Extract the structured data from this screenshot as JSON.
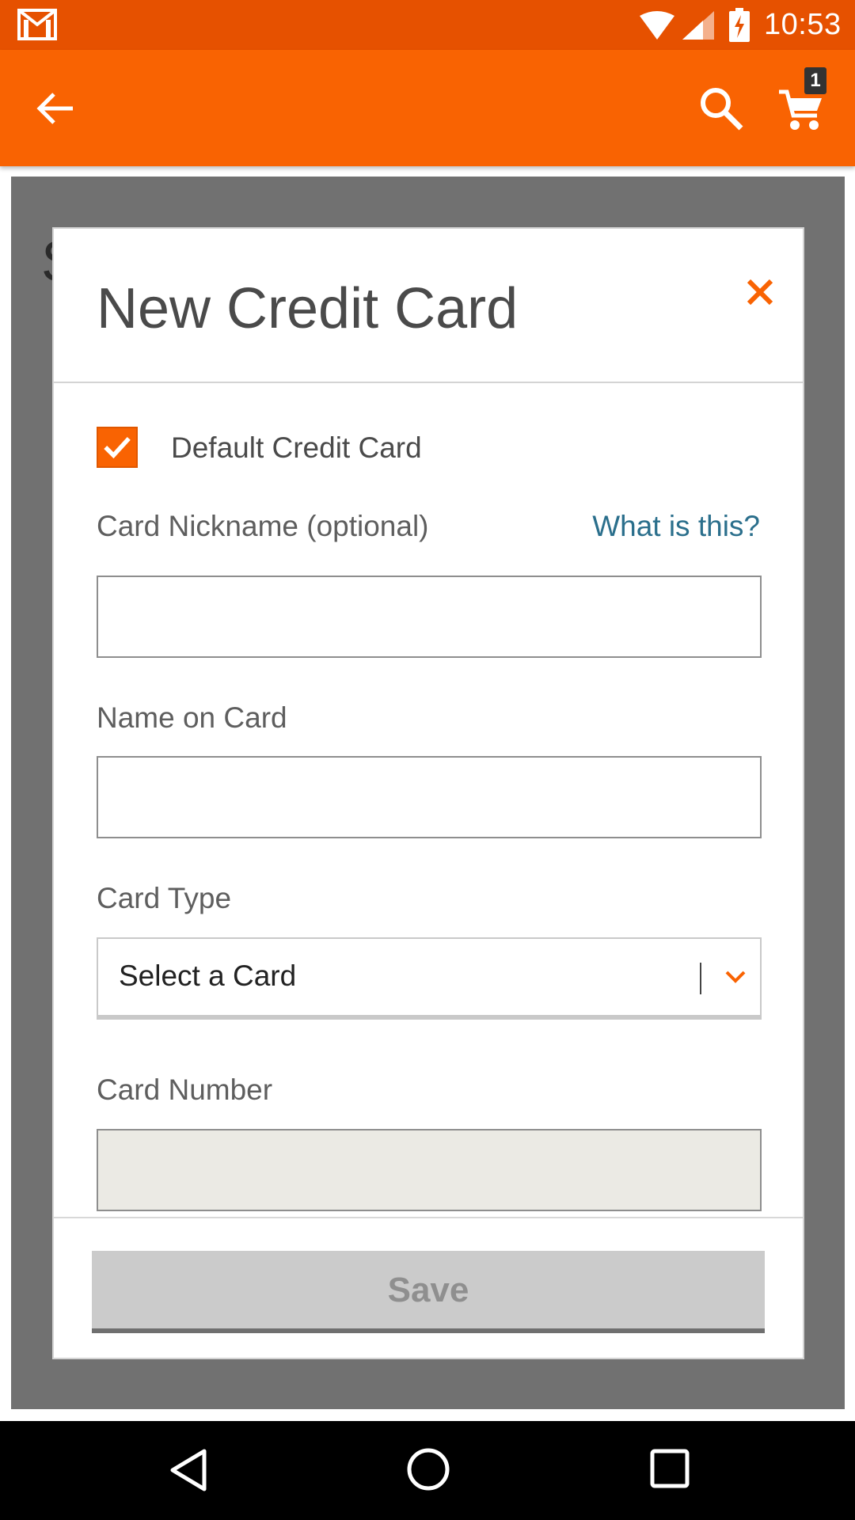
{
  "status_bar": {
    "time": "10:53",
    "icons": [
      "gmail-icon",
      "wifi-icon",
      "cell-signal-icon",
      "battery-charging-icon"
    ]
  },
  "app_bar": {
    "icons": [
      "back-arrow-icon",
      "search-icon",
      "cart-icon"
    ],
    "cart_count": "1",
    "accent_color": "#f96302"
  },
  "background": {
    "peek_text": "S"
  },
  "modal": {
    "title": "New Credit Card",
    "close_icon": "close-icon",
    "default_card": {
      "label": "Default Credit Card",
      "checked": true
    },
    "nickname": {
      "label": "Card Nickname (optional)",
      "help_link": "What is this?",
      "value": ""
    },
    "name_on_card": {
      "label": "Name on Card",
      "value": ""
    },
    "card_type": {
      "label": "Card Type",
      "selected": "Select a Card"
    },
    "card_number": {
      "label": "Card Number",
      "value": ""
    },
    "save_label": "Save"
  },
  "nav_bar": {
    "icons": [
      "nav-back-icon",
      "nav-home-icon",
      "nav-recents-icon"
    ]
  }
}
